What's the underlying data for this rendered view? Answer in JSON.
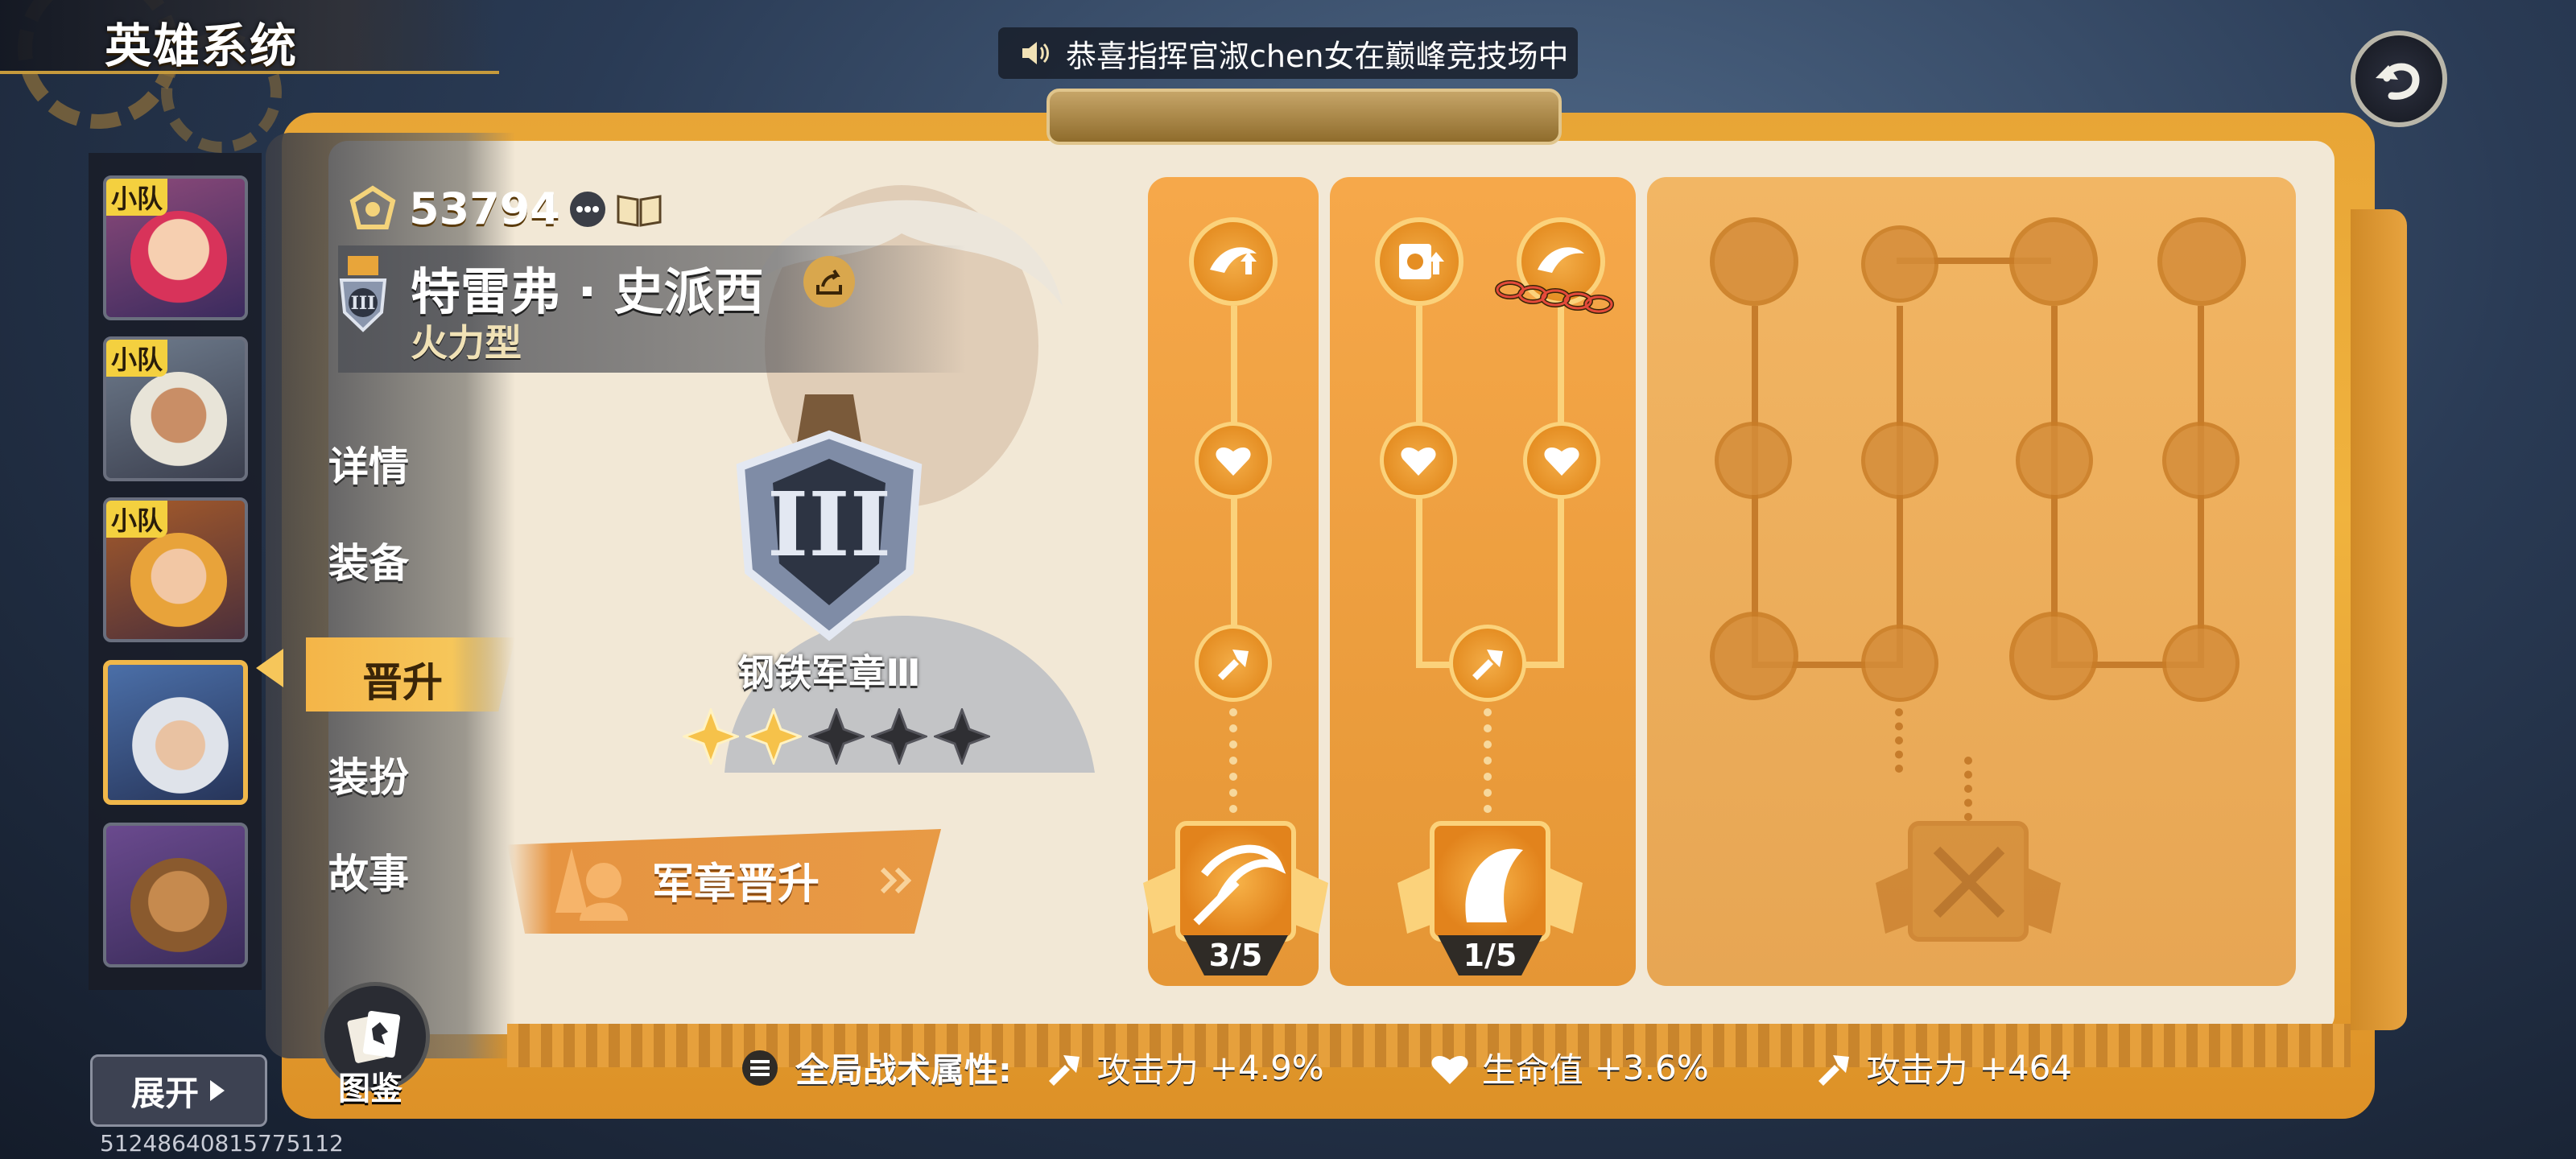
{
  "header": {
    "title": "英雄系统",
    "ticker": "恭喜指挥官淑chen女在巅峰竞技场中"
  },
  "hero_list": {
    "team_tag": "小队",
    "expand_label": "展开",
    "user_id": "51248640815775112"
  },
  "nav": {
    "items": [
      "详情",
      "装备",
      "晋升",
      "装扮",
      "故事"
    ],
    "active": "晋升",
    "codex_label": "图鉴"
  },
  "hero": {
    "power": "53794",
    "name": "特雷弗 · 史派西",
    "class": "火力型"
  },
  "medal": {
    "name": "钢铁军章Ⅲ",
    "stars_filled": 2,
    "stars_total": 5,
    "promote_label": "军章晋升"
  },
  "trees": [
    {
      "progress": "3/5"
    },
    {
      "progress": "1/5"
    }
  ],
  "stats": {
    "title": "全局战术属性:",
    "items": [
      {
        "icon": "attack-icon",
        "label": "攻击力",
        "value": "+4.9%"
      },
      {
        "icon": "health-icon",
        "label": "生命值",
        "value": "+3.6%"
      },
      {
        "icon": "attack-icon",
        "label": "攻击力",
        "value": "+464"
      }
    ]
  },
  "colors": {
    "board": "#f0b33e",
    "accent": "#fbd27b",
    "star_filled": "#f6c24a",
    "star_empty": "#2f2f33"
  }
}
